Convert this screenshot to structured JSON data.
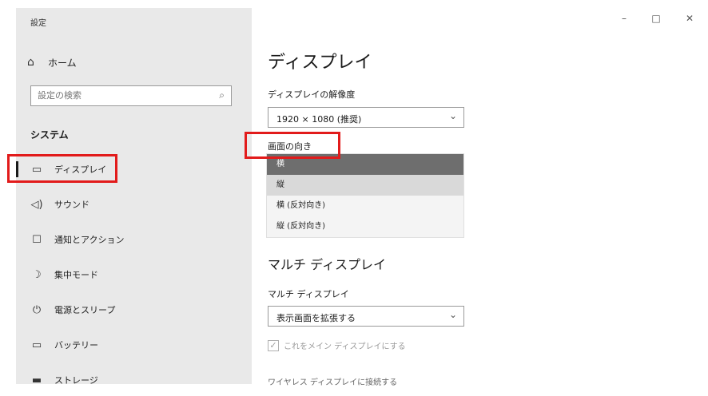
{
  "window": {
    "title": "設定"
  },
  "window_controls": {
    "minimize": "–",
    "maximize": "□",
    "close": "✕"
  },
  "sidebar": {
    "home_label": "ホーム",
    "search_placeholder": "設定の検索",
    "group_title": "システム",
    "items": [
      {
        "label": "ディスプレイ",
        "icon": "monitor-icon"
      },
      {
        "label": "サウンド",
        "icon": "speaker-icon"
      },
      {
        "label": "通知とアクション",
        "icon": "notification-icon"
      },
      {
        "label": "集中モード",
        "icon": "moon-icon"
      },
      {
        "label": "電源とスリープ",
        "icon": "power-icon"
      },
      {
        "label": "バッテリー",
        "icon": "battery-icon"
      },
      {
        "label": "ストレージ",
        "icon": "storage-icon"
      }
    ]
  },
  "main": {
    "page_title": "ディスプレイ",
    "resolution": {
      "label": "ディスプレイの解像度",
      "value": "1920 × 1080 (推奨)"
    },
    "orientation": {
      "label": "画面の向き",
      "options": [
        "横",
        "縦",
        "横 (反対向き)",
        "縦 (反対向き)"
      ],
      "selected": "横",
      "hovered": "縦"
    },
    "multi_display": {
      "section_title": "マルチ ディスプレイ",
      "label": "マルチ ディスプレイ",
      "value": "表示画面を拡張する",
      "checkbox_label": "これをメイン ディスプレイにする",
      "checkbox_checked": true
    },
    "wireless_link": "ワイヤレス ディスプレイに接続する"
  },
  "colors": {
    "highlight_box": "#e21b1b",
    "sidebar_bg": "#e9e9e9",
    "selected_option_bg": "#6e6e6e"
  }
}
